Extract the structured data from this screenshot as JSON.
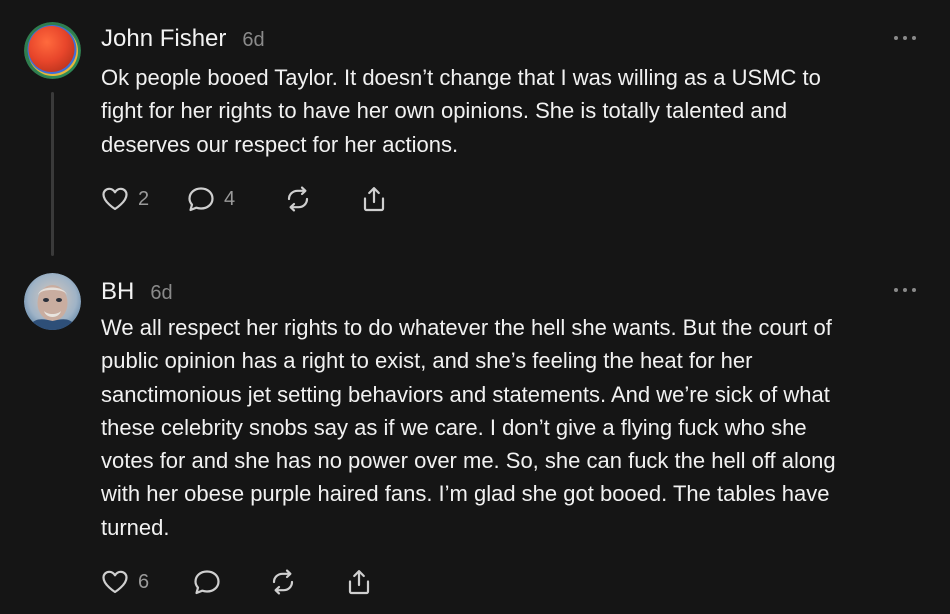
{
  "posts": [
    {
      "author": "John Fisher",
      "time": "6d",
      "lines": [
        "Ok people booed Taylor. It doesn’t change that I was willing as a USMC to",
        "fight for her rights to have her own opinions. She is totally talented and",
        "deserves our respect for her actions."
      ],
      "likes": "2",
      "replies": "4",
      "icons": [
        "heart-icon",
        "comment-icon",
        "repost-icon",
        "share-icon",
        "more-icon"
      ]
    },
    {
      "author": "BH",
      "time": "6d",
      "lines": [
        "We all respect her rights to do whatever the hell she wants. But the court of",
        "public opinion has a right to exist, and she’s feeling the heat for her",
        "sanctimonious jet setting behaviors and statements. And we’re sick of what",
        "these celebrity snobs say as if we care. I don’t give a flying fuck who she",
        "votes for and she has no power over me. So, she can fuck the hell off along",
        "with her obese purple haired fans. I’m glad she got booed. The tables have",
        "turned."
      ],
      "likes": "6",
      "replies": "",
      "icons": [
        "heart-icon",
        "comment-icon",
        "repost-icon",
        "share-icon",
        "more-icon"
      ]
    }
  ],
  "colors": {
    "background": "#151515",
    "text": "#f1f1f1",
    "muted": "#8a8a8a",
    "thread_line": "#3a3a3a"
  }
}
